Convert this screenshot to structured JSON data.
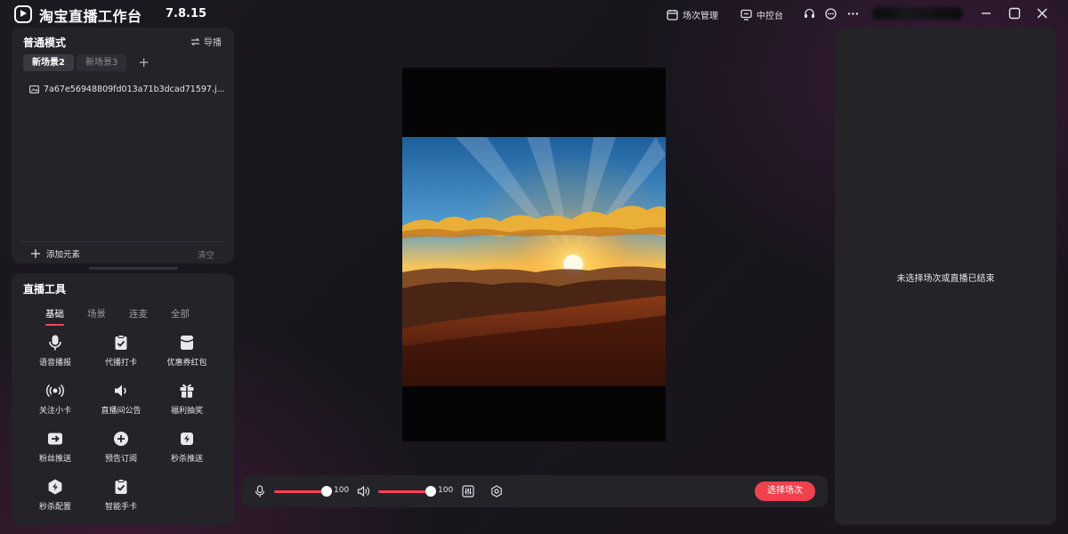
{
  "app": {
    "title": "淘宝直播工作台",
    "version": "7.8.15"
  },
  "titlebar": {
    "session_mgmt_label": "场次管理",
    "control_center_label": "中控台"
  },
  "scene_panel": {
    "mode_title": "普通模式",
    "guide_label": "导播",
    "tabs": [
      {
        "label": "新场景2",
        "active": true
      },
      {
        "label": "新场景3",
        "active": false
      }
    ],
    "add_tab_label": "+",
    "elements": [
      {
        "name": "7a67e56948809fd013a71b3dcad71597.j...",
        "icon": "image-icon"
      }
    ],
    "add_element_label": "添加元素",
    "clear_label": "清空"
  },
  "tools_panel": {
    "title": "直播工具",
    "tabs": [
      {
        "label": "基础",
        "active": true
      },
      {
        "label": "场景"
      },
      {
        "label": "连麦"
      },
      {
        "label": "全部"
      }
    ],
    "items": [
      {
        "label": "语音播报",
        "icon": "microphone-icon"
      },
      {
        "label": "代播打卡",
        "icon": "clipboard-check-icon"
      },
      {
        "label": "优惠券红包",
        "icon": "coupon-envelope-icon"
      },
      {
        "label": "关注小卡",
        "icon": "broadcast-icon"
      },
      {
        "label": "直播间公告",
        "icon": "speaker-icon"
      },
      {
        "label": "福利抽奖",
        "icon": "gift-icon"
      },
      {
        "label": "粉丝推送",
        "icon": "push-arrow-icon"
      },
      {
        "label": "预告订阅",
        "icon": "subscribe-plus-icon"
      },
      {
        "label": "秒杀推送",
        "icon": "flash-sale-icon"
      },
      {
        "label": "秒杀配置",
        "icon": "flash-config-icon"
      },
      {
        "label": "智能手卡",
        "icon": "smart-card-icon"
      }
    ]
  },
  "control_bar": {
    "mic_volume": 100,
    "speaker_volume": 100,
    "select_session_label": "选择场次"
  },
  "right_panel": {
    "empty_message": "未选择场次或直播已结束"
  },
  "colors": {
    "accent": "#ff4058",
    "panel": "#242328",
    "button": "#f0414f"
  }
}
